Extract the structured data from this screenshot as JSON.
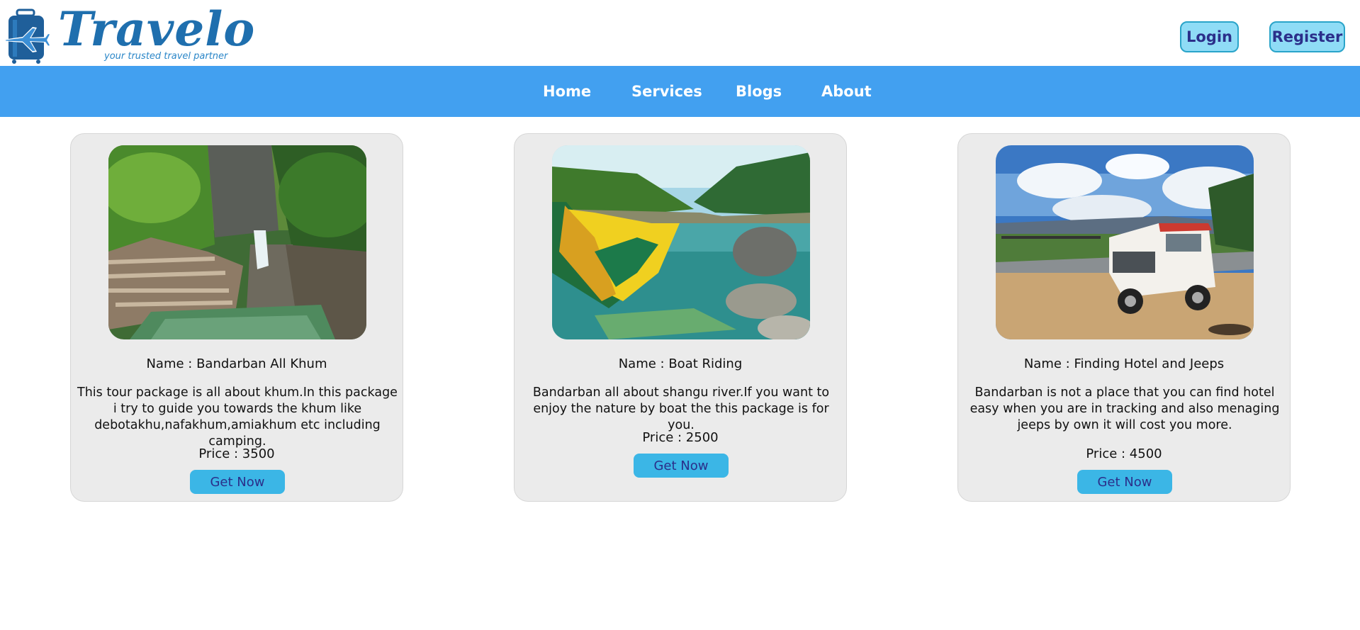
{
  "brand": {
    "name": "Travelo",
    "tagline": "your trusted travel partner",
    "colors": {
      "primary": "#1f6fae",
      "accent": "#42a0f0"
    },
    "icon": "suitcase-plane-logo-icon"
  },
  "auth": {
    "login_label": "Login",
    "register_label": "Register"
  },
  "nav": {
    "items": [
      {
        "label": "Home"
      },
      {
        "label": "Services"
      },
      {
        "label": "Blogs"
      },
      {
        "label": "About"
      }
    ]
  },
  "packages": [
    {
      "name": "Name : Bandarban All Khum",
      "description": "This tour package is all about khum.In this package i try to guide you towards the khum like debotakhu,nafakhum,amiakhum etc including camping.",
      "price": "Price : 3500",
      "button_label": "Get Now",
      "image": "waterfall-canyon-photo"
    },
    {
      "name": "Name : Boat Riding",
      "description": "Bandarban all about shangu river.If you want to enjoy the nature by boat the this package is for you.",
      "price": "Price : 2500",
      "button_label": "Get Now",
      "image": "river-boat-photo"
    },
    {
      "name": "Name : Finding Hotel and Jeeps",
      "description": "Bandarban is not a place that you can find hotel easy when you are in tracking and also menaging jeeps by own it will cost you more.",
      "price": "Price : 4500",
      "button_label": "Get Now",
      "image": "jeep-photo"
    }
  ]
}
